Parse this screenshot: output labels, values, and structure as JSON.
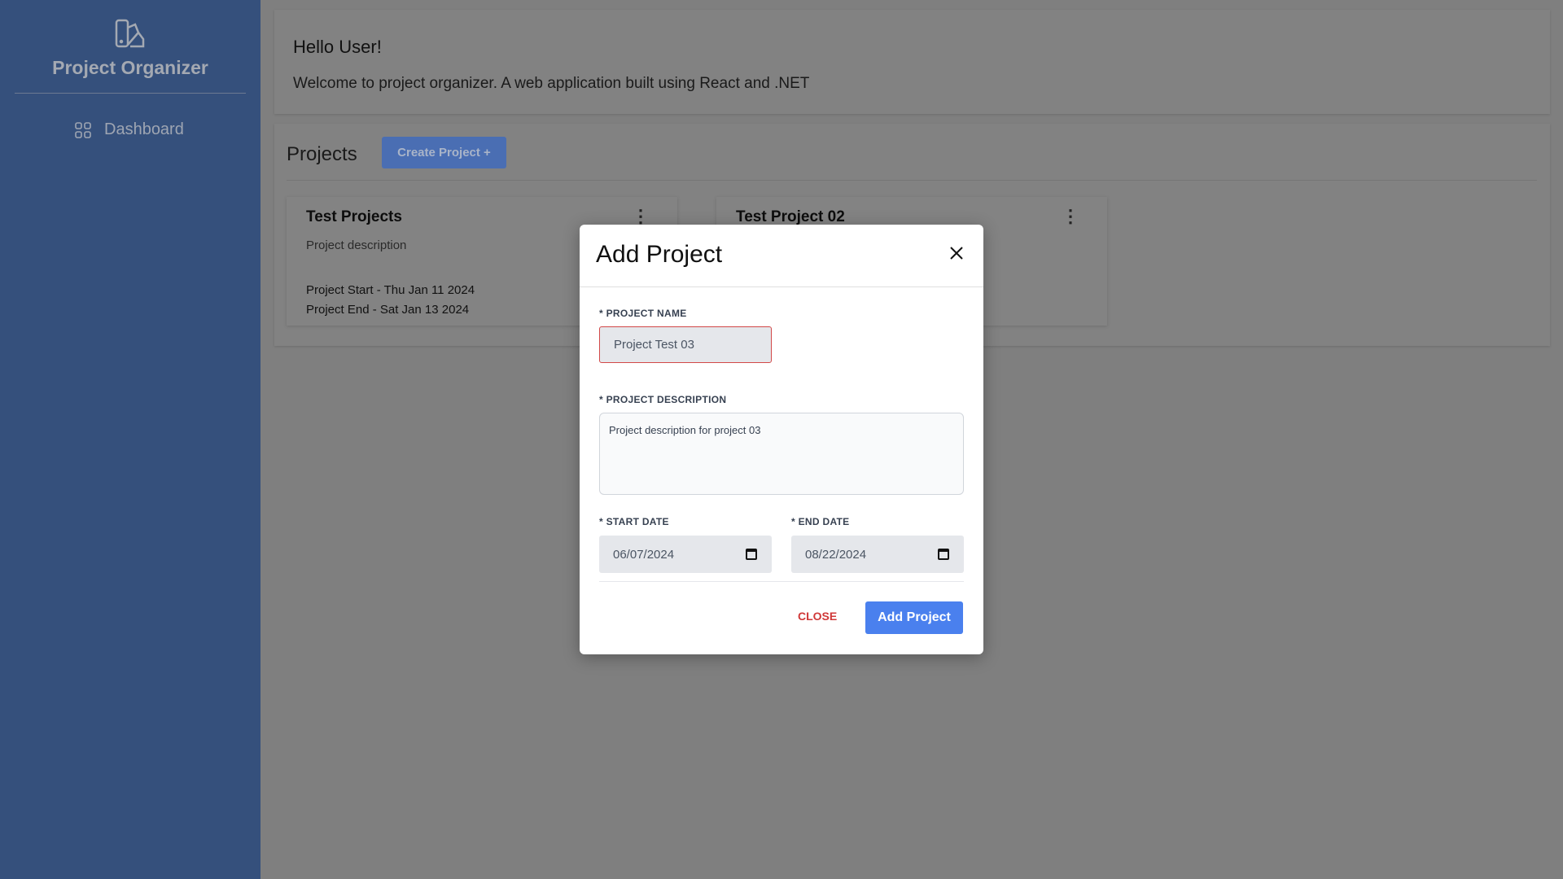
{
  "sidebar": {
    "brand": "Project Organizer",
    "items": [
      {
        "label": "Dashboard",
        "icon": "grid-icon"
      }
    ]
  },
  "header": {
    "greeting": "Hello User!",
    "welcome": "Welcome to project organizer. A web application built using React and .NET"
  },
  "projects": {
    "title": "Projects",
    "create_label": "Create Project +",
    "cards": [
      {
        "title": "Test Projects",
        "description": "Project description",
        "start": "Project Start - Thu Jan 11 2024",
        "end": "Project End - Sat Jan 13 2024"
      },
      {
        "title": "Test Project 02"
      }
    ]
  },
  "modal": {
    "title": "Add Project",
    "name_label": "* PROJECT NAME",
    "name_value": "Project Test 03",
    "desc_label": "* PROJECT DESCRIPTION",
    "desc_value": "Project description for project 03",
    "start_label": "* START DATE",
    "start_value": "06/07/2024",
    "end_label": "* END DATE",
    "end_value": "08/22/2024",
    "close_label": "CLOSE",
    "submit_label": "Add Project"
  },
  "colors": {
    "sidebar": "#35507c",
    "primary": "#4a80ee",
    "danger": "#d03838",
    "overlay": "#7f7f7f"
  }
}
